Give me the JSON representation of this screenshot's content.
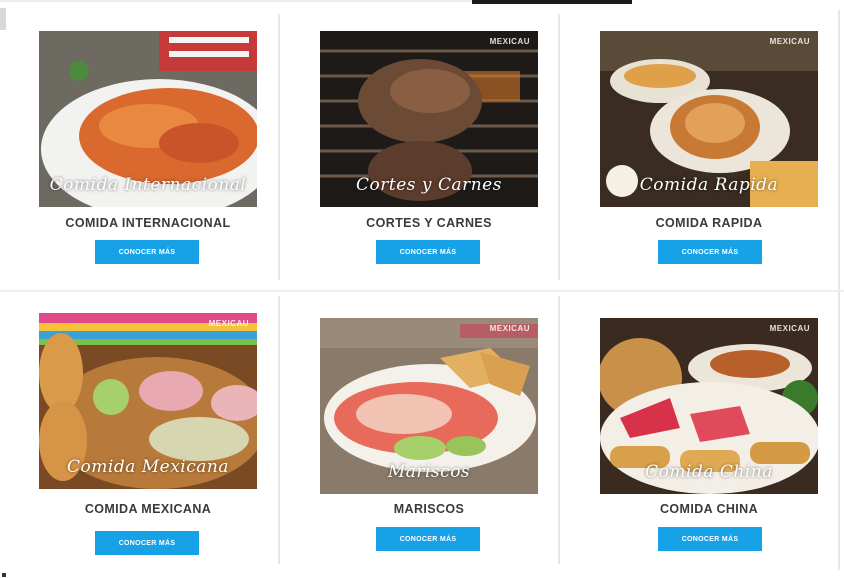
{
  "cards": [
    {
      "title": "COMIDA INTERNACIONAL",
      "caption": "Comida Internacional",
      "logo": "",
      "button": "CONOCER MÁS"
    },
    {
      "title": "CORTES Y CARNES",
      "caption": "Cortes y Carnes",
      "logo": "MEXICAU",
      "button": "CONOCER MÁS"
    },
    {
      "title": "COMIDA RAPIDA",
      "caption": "Comida Rapida",
      "logo": "MEXICAU",
      "button": "CONOCER MÁS"
    },
    {
      "title": "COMIDA MEXICANA",
      "caption": "Comida Mexicana",
      "logo": "MEXICAU",
      "button": "CONOCER MÁS"
    },
    {
      "title": "MARISCOS",
      "caption": "Mariscos",
      "logo": "MEXICAU",
      "button": "CONOCER MÁS"
    },
    {
      "title": "COMIDA CHINA",
      "caption": "Comida China",
      "logo": "MEXICAU",
      "button": "CONOCER MÁS"
    }
  ],
  "colors": {
    "button": "#17a2e8",
    "title": "#3a3a3a",
    "divider": "#e6e6e6"
  }
}
